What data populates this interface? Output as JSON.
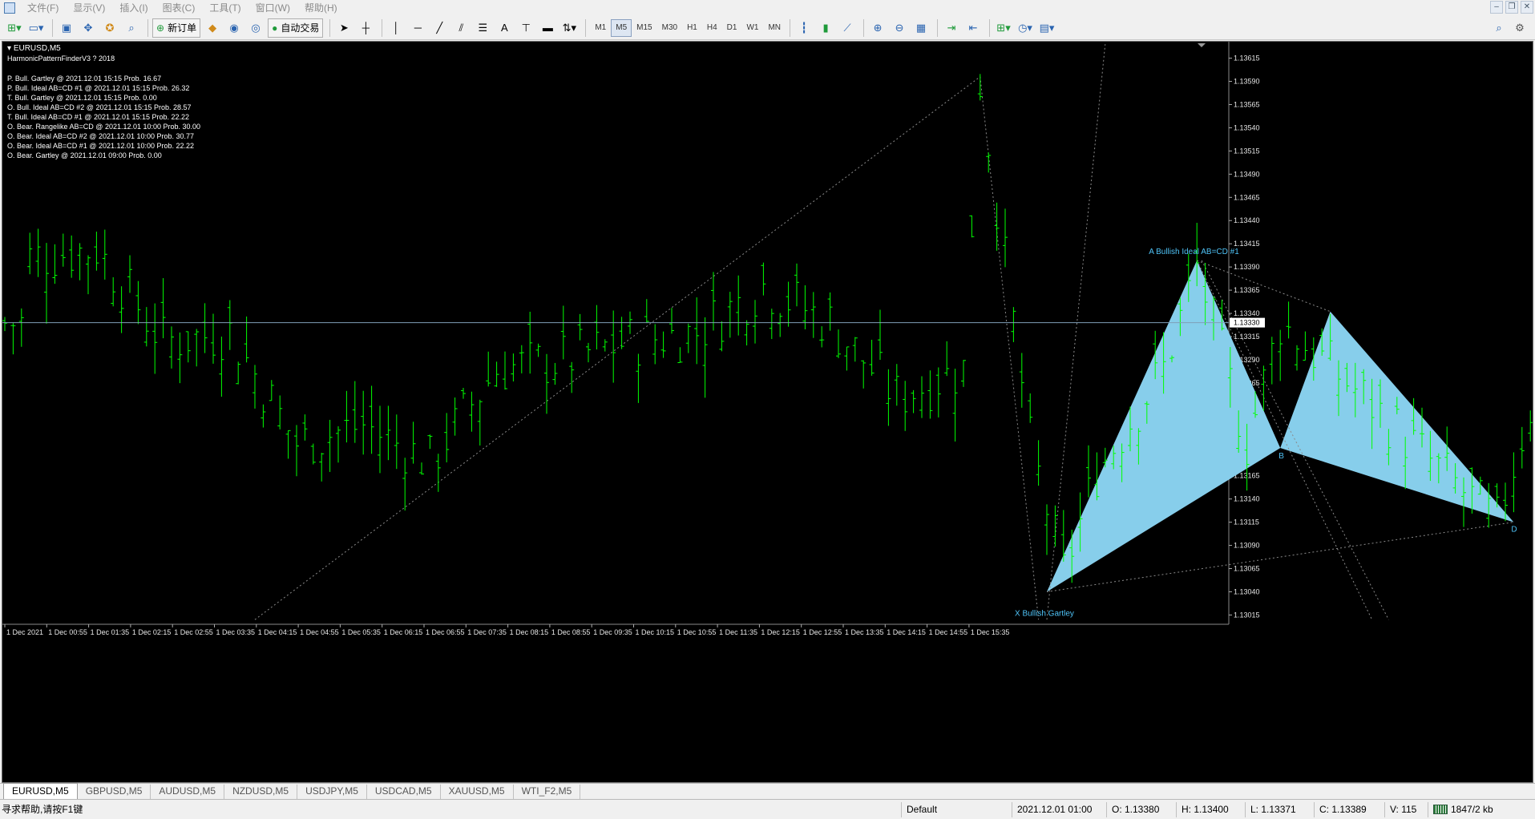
{
  "menu": [
    "文件(F)",
    "显示(V)",
    "插入(I)",
    "图表(C)",
    "工具(T)",
    "窗口(W)",
    "帮助(H)"
  ],
  "toolbar": {
    "new_order_label": "新订单",
    "auto_trading_label": "自动交易",
    "timeframes": [
      "M1",
      "M5",
      "M15",
      "M30",
      "H1",
      "H4",
      "D1",
      "W1",
      "MN"
    ],
    "active_timeframe": "M5"
  },
  "chart_header": {
    "symbol": "EURUSD,M5",
    "indicator": "HarmonicPatternFinderV3 ? 2018"
  },
  "patterns": [
    "P. Bull. Gartley @ 2021.12.01 15:15 Prob. 16.67",
    "P. Bull. Ideal AB=CD #1 @ 2021.12.01 15:15 Prob. 26.32",
    "T. Bull. Gartley @ 2021.12.01 15:15 Prob. 0.00",
    "O. Bull. Ideal AB=CD #2 @ 2021.12.01 15:15 Prob. 28.57",
    "T. Bull. Ideal AB=CD #1 @ 2021.12.01 15:15 Prob. 22.22",
    "O. Bear. Rangelike AB=CD @ 2021.12.01 10:00 Prob. 30.00",
    "O. Bear. Ideal AB=CD #2 @ 2021.12.01 10:00 Prob. 30.77",
    "O. Bear. Ideal AB=CD #1 @ 2021.12.01 10:00 Prob. 22.22",
    "O. Bear. Gartley @ 2021.12.01 09:00 Prob. 0.00"
  ],
  "chart_labels": {
    "pattern_a": "A Bullish Ideal AB=CD #1",
    "point_b": "B",
    "point_d": "D",
    "pattern_x": "X Bullish Gartley"
  },
  "chart_data": {
    "type": "bar",
    "symbol": "EURUSD",
    "timeframe": "M5",
    "y_ticks": [
      "1.13615",
      "1.13590",
      "1.13565",
      "1.13540",
      "1.13515",
      "1.13490",
      "1.13465",
      "1.13440",
      "1.13415",
      "1.13390",
      "1.13365",
      "1.13340",
      "1.13315",
      "1.13290",
      "1.13265",
      "1.13240",
      "1.13215",
      "1.13190",
      "1.13165",
      "1.13140",
      "1.13115",
      "1.13090",
      "1.13065",
      "1.13040",
      "1.13015"
    ],
    "ylim": [
      1.13005,
      1.13625
    ],
    "current_price": "1.13330",
    "x_ticks": [
      "1 Dec 2021",
      "1 Dec 00:55",
      "1 Dec 01:35",
      "1 Dec 02:15",
      "1 Dec 02:55",
      "1 Dec 03:35",
      "1 Dec 04:15",
      "1 Dec 04:55",
      "1 Dec 05:35",
      "1 Dec 06:15",
      "1 Dec 06:55",
      "1 Dec 07:35",
      "1 Dec 08:15",
      "1 Dec 08:55",
      "1 Dec 09:35",
      "1 Dec 10:15",
      "1 Dec 10:55",
      "1 Dec 11:35",
      "1 Dec 12:15",
      "1 Dec 12:55",
      "1 Dec 13:35",
      "1 Dec 14:15",
      "1 Dec 14:55",
      "1 Dec 15:35"
    ],
    "price_anchors": [
      {
        "time": "00:15",
        "price": 1.134
      },
      {
        "time": "00:55",
        "price": 1.1341
      },
      {
        "time": "01:35",
        "price": 1.1331
      },
      {
        "time": "02:15",
        "price": 1.1332
      },
      {
        "time": "02:55",
        "price": 1.132
      },
      {
        "time": "03:35",
        "price": 1.1322
      },
      {
        "time": "04:15",
        "price": 1.1318
      },
      {
        "time": "04:55",
        "price": 1.1328
      },
      {
        "time": "05:35",
        "price": 1.1329
      },
      {
        "time": "06:15",
        "price": 1.1331
      },
      {
        "time": "06:55",
        "price": 1.1332
      },
      {
        "time": "07:35",
        "price": 1.1337
      },
      {
        "time": "08:15",
        "price": 1.1333
      },
      {
        "time": "08:55",
        "price": 1.1325
      },
      {
        "time": "09:35",
        "price": 1.1328
      },
      {
        "time": "09:45",
        "price": 1.1359
      },
      {
        "time": "10:15",
        "price": 1.132
      },
      {
        "time": "10:35",
        "price": 1.1306
      },
      {
        "time": "10:55",
        "price": 1.1317
      },
      {
        "time": "11:35",
        "price": 1.1328
      },
      {
        "time": "11:55",
        "price": 1.1339
      },
      {
        "time": "12:25",
        "price": 1.132
      },
      {
        "time": "12:45",
        "price": 1.1333
      },
      {
        "time": "13:35",
        "price": 1.1325
      },
      {
        "time": "14:15",
        "price": 1.1318
      },
      {
        "time": "14:55",
        "price": 1.13115
      },
      {
        "time": "15:25",
        "price": 1.133
      },
      {
        "time": "15:35",
        "price": 1.1333
      }
    ],
    "pattern_points": {
      "X": {
        "time": "10:25",
        "price": 1.1304
      },
      "A": {
        "time": "11:55",
        "price": 1.13397
      },
      "B": {
        "time": "12:45",
        "price": 1.13195
      },
      "C": {
        "time": "13:15",
        "price": 1.13342
      },
      "D": {
        "time": "15:05",
        "price": 1.13115
      }
    },
    "colors": {
      "bars": "#00ff00",
      "pattern_fill": "#87ceeb",
      "grid": "#9a9a9a",
      "labels": "#4fc3f7"
    }
  },
  "symbol_tabs": [
    "EURUSD,M5",
    "GBPUSD,M5",
    "AUDUSD,M5",
    "NZDUSD,M5",
    "USDJPY,M5",
    "USDCAD,M5",
    "XAUUSD,M5",
    "WTI_F2,M5"
  ],
  "active_tab": "EURUSD,M5",
  "status": {
    "help": "寻求帮助,请按F1键",
    "profile": "Default",
    "datetime": "2021.12.01 01:00",
    "open": "O: 1.13380",
    "high": "H: 1.13400",
    "low": "L: 1.13371",
    "close": "C: 1.13389",
    "volume": "V: 115",
    "traffic": "1847/2 kb"
  }
}
